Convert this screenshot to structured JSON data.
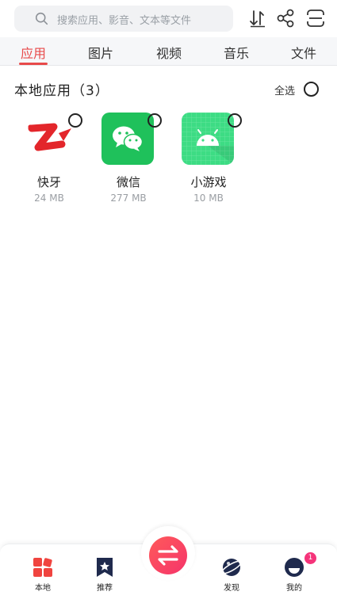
{
  "search": {
    "placeholder": "搜索应用、影音、文本等文件"
  },
  "tabs": [
    {
      "label": "应用",
      "active": true
    },
    {
      "label": "图片"
    },
    {
      "label": "视频"
    },
    {
      "label": "音乐"
    },
    {
      "label": "文件"
    }
  ],
  "section": {
    "title": "本地应用（3）",
    "select_all": "全选"
  },
  "apps": [
    {
      "name": "快牙",
      "size": "24 MB",
      "icon": "kuaiya-icon"
    },
    {
      "name": "微信",
      "size": "277 MB",
      "icon": "wechat-icon"
    },
    {
      "name": "小游戏",
      "size": "10 MB",
      "icon": "android-game-icon"
    }
  ],
  "bottom_nav": [
    {
      "label": "本地",
      "icon": "apps-grid-icon"
    },
    {
      "label": "推荐",
      "icon": "bookmark-star-icon"
    },
    {
      "label": "发现",
      "icon": "planet-icon"
    },
    {
      "label": "我的",
      "icon": "avatar-icon",
      "badge": "1"
    }
  ],
  "colors": {
    "accent": "#e84a4a",
    "wechat": "#1fc15b",
    "game": "#3ddc84"
  }
}
